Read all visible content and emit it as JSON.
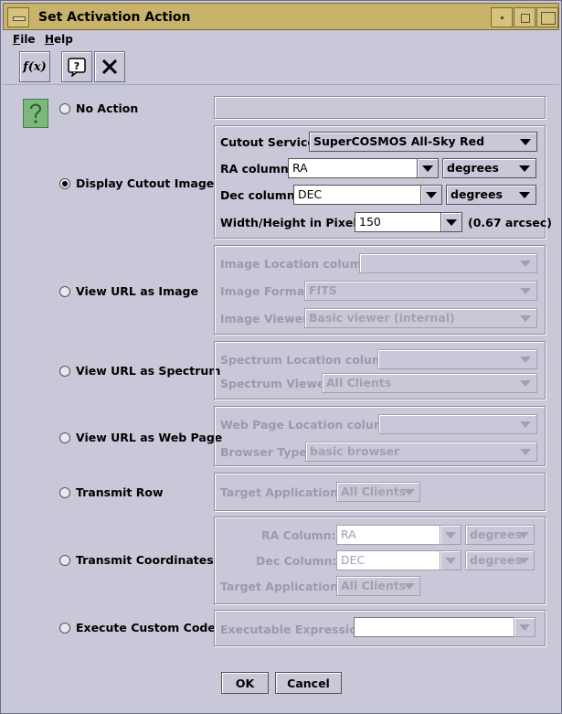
{
  "window": {
    "title": "Set Activation Action"
  },
  "menu": {
    "file": "File",
    "help": "Help"
  },
  "toolbar": {
    "fx_icon": "f(x)",
    "help_icon": "help-icon",
    "close_icon": "close-icon"
  },
  "options": [
    {
      "label": "No Action",
      "selected": false
    },
    {
      "label": "Display Cutout Image",
      "selected": true
    },
    {
      "label": "View URL as Image",
      "selected": false
    },
    {
      "label": "View URL as Spectrum",
      "selected": false
    },
    {
      "label": "View URL as Web Page",
      "selected": false
    },
    {
      "label": "Transmit Row",
      "selected": false
    },
    {
      "label": "Transmit Coordinates",
      "selected": false
    },
    {
      "label": "Execute Custom Code",
      "selected": false
    }
  ],
  "cutout": {
    "service_label": "Cutout Service:",
    "service_value": "SuperCOSMOS All-Sky Red",
    "ra_label": "RA column:",
    "ra_value": "RA",
    "ra_unit": "degrees",
    "dec_label": "Dec column:",
    "dec_value": "DEC",
    "dec_unit": "degrees",
    "size_label": "Width/Height in Pixels:",
    "size_value": "150",
    "size_note": "(0.67 arcsec)"
  },
  "url_image": {
    "location_label": "Image Location column:",
    "format_label": "Image Format:",
    "format_value": "FITS",
    "viewer_label": "Image Viewer:",
    "viewer_value": "Basic viewer (internal)"
  },
  "url_spectrum": {
    "location_label": "Spectrum Location column:",
    "viewer_label": "Spectrum Viewer:",
    "viewer_value": "All Clients"
  },
  "url_web": {
    "location_label": "Web Page Location column:",
    "browser_label": "Browser Type:",
    "browser_value": "basic browser"
  },
  "transmit_row": {
    "target_label": "Target Application:",
    "target_value": "All Clients"
  },
  "transmit_coords": {
    "ra_label": "RA Column:",
    "ra_value": "RA",
    "ra_unit": "degrees",
    "dec_label": "Dec Column:",
    "dec_value": "DEC",
    "dec_unit": "degrees",
    "target_label": "Target Application:",
    "target_value": "All Clients"
  },
  "custom_code": {
    "expr_label": "Executable Expression:"
  },
  "buttons": {
    "ok": "OK",
    "cancel": "Cancel"
  }
}
